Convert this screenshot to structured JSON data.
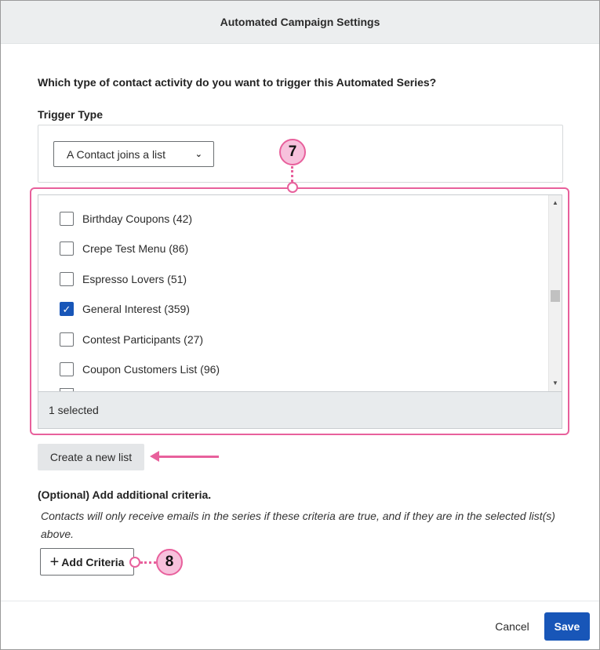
{
  "dialog": {
    "title": "Automated Campaign Settings"
  },
  "trigger": {
    "question": "Which type of contact activity do you want to trigger this Automated Series?",
    "label": "Trigger Type",
    "selected_value": "A Contact joins a list",
    "chevron_icon": "chevron-down-icon"
  },
  "lists": {
    "items": [
      {
        "label": "Birthday Coupons  (42)",
        "checked": false
      },
      {
        "label": "Crepe Test Menu (86)",
        "checked": false
      },
      {
        "label": "Espresso Lovers (51)",
        "checked": false
      },
      {
        "label": "General Interest (359)",
        "checked": true
      },
      {
        "label": "Contest Participants  (27)",
        "checked": false
      },
      {
        "label": "Coupon Customers List  (96)",
        "checked": false
      }
    ],
    "selected_summary": "1 selected"
  },
  "actions": {
    "create_list_label": "Create a new list"
  },
  "criteria": {
    "title": "(Optional) Add additional criteria.",
    "description": "Contacts will only receive emails in the series if these criteria are true, and if they are in the selected list(s) above.",
    "add_label": "Add Criteria",
    "plus_icon": "plus-icon"
  },
  "annotations": {
    "callout_lists": "7",
    "callout_criteria": "8",
    "highlight_color": "#e8609c",
    "badge_fill": "#f7c1dc"
  },
  "footer": {
    "cancel_label": "Cancel",
    "save_label": "Save",
    "primary_color": "#1856b8"
  }
}
